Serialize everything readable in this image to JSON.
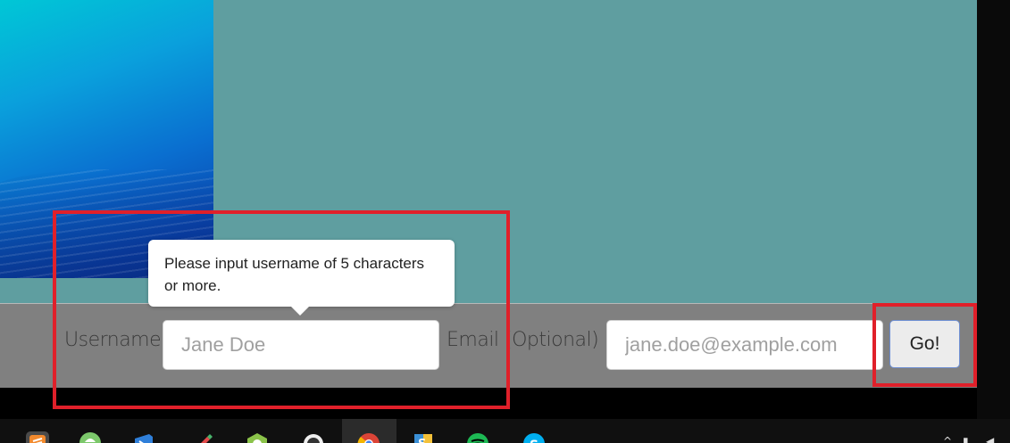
{
  "form": {
    "username_label": "Username",
    "username_placeholder": "Jane Doe",
    "email_label": "Email (Optional)",
    "email_placeholder": "jane.doe@example.com",
    "submit_label": "Go!"
  },
  "tooltip": {
    "text": "Please input username of 5 characters or more."
  },
  "colors": {
    "page_background": "#5f9ea0",
    "form_bar": "#808080",
    "highlight": "#e0202a"
  },
  "taskbar": {
    "icons": [
      "sublime-text-icon",
      "android-icon",
      "visual-studio-icon",
      "pencil-app-icon",
      "android-studio-icon",
      "github-desktop-icon",
      "chrome-icon",
      "tortoise-icon",
      "spotify-icon",
      "skype-icon"
    ],
    "active_icon": "chrome-icon"
  }
}
